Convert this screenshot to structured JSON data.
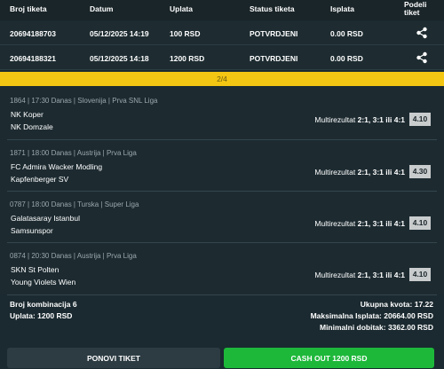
{
  "header": {
    "col_ticket": "Broj tiketa",
    "col_date": "Datum",
    "col_payment": "Uplata",
    "col_status": "Status tiketa",
    "col_payout": "Isplata",
    "col_share_1": "Podeli",
    "col_share_2": "tiket"
  },
  "tickets": [
    {
      "id": "20694188703",
      "date": "05/12/2025 14:19",
      "payment": "100 RSD",
      "status": "POTVRDJENI",
      "payout": "0.00 RSD"
    },
    {
      "id": "20694188321",
      "date": "05/12/2025 14:18",
      "payment": "1200 RSD",
      "status": "POTVRDJENI",
      "payout": "0.00 RSD"
    }
  ],
  "pager": {
    "label": "2/4"
  },
  "matches": [
    {
      "header": "1864 | 17:30 Danas | Slovenija | Prva SNL Liga",
      "home": "NK Koper",
      "away": "NK Domzale",
      "market": "Multirezultat",
      "pick": "2:1, 3:1 ili 4:1",
      "odd": "4.10"
    },
    {
      "header": "1871 | 18:00 Danas | Austrija | Prva Liga",
      "home": "FC Admira Wacker Modling",
      "away": "Kapfenberger SV",
      "market": "Multirezultat",
      "pick": "2:1, 3:1 ili 4:1",
      "odd": "4.30"
    },
    {
      "header": "0787 | 18:00 Danas | Turska | Super Liga",
      "home": "Galatasaray Istanbul",
      "away": "Samsunspor",
      "market": "Multirezultat",
      "pick": "2:1, 3:1 ili 4:1",
      "odd": "4.10"
    },
    {
      "header": "0874 | 20:30 Danas | Austrija | Prva Liga",
      "home": "SKN St Polten",
      "away": "Young Violets Wien",
      "market": "Multirezultat",
      "pick": "2:1, 3:1 ili 4:1",
      "odd": "4.10"
    }
  ],
  "summary": {
    "combinations": "Broj kombinacija 6",
    "payment": "Uplata: 1200 RSD",
    "total_odds": "Ukupna kvota: 17.22",
    "max_payout": "Maksimalna Isplata: 20664.00 RSD",
    "min_win": "Minimalni dobitak: 3362.00 RSD"
  },
  "buttons": {
    "repeat": "PONOVI TIKET",
    "cashout": "CASH OUT 1200 RSD"
  },
  "colors": {
    "pager": "#f3c613",
    "cashout": "#1db83a",
    "repeat": "#2d3c43"
  }
}
